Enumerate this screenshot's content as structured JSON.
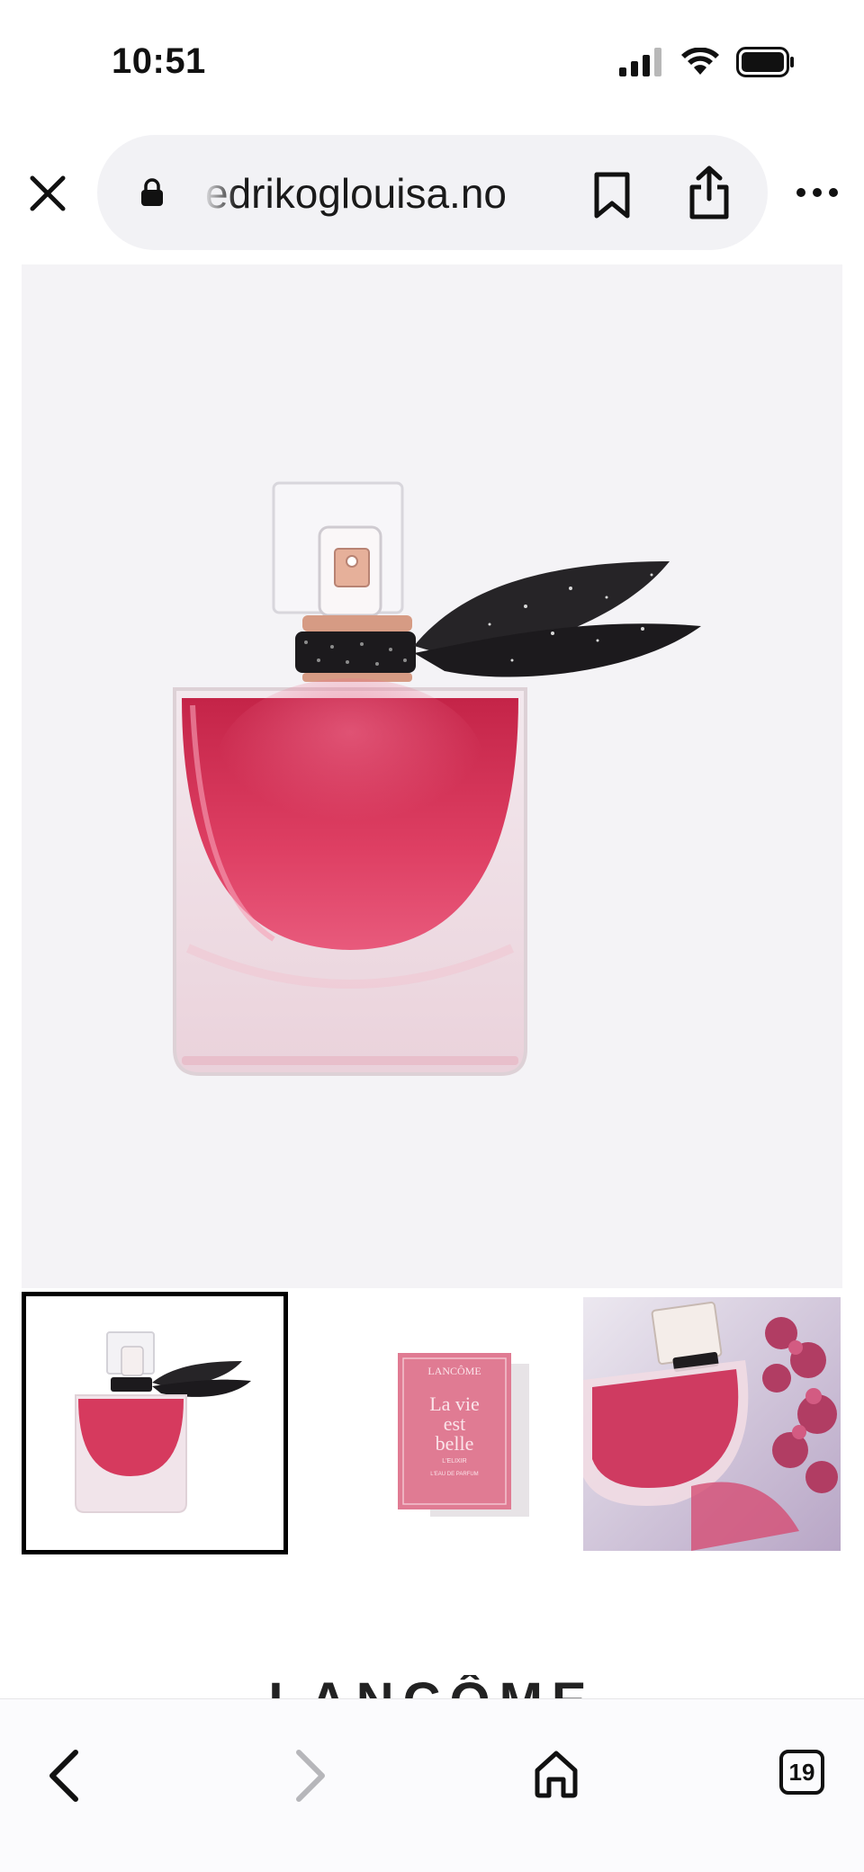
{
  "status_bar": {
    "time": "10:51",
    "icons": [
      "signal-icon",
      "wifi-icon",
      "battery-icon"
    ]
  },
  "browser": {
    "url_display": "edrikoglouisa.no",
    "secure": true,
    "buttons": [
      "close-icon",
      "bookmark-icon",
      "share-icon",
      "more-icon"
    ]
  },
  "product": {
    "main_image": "perfume-bottle-pink-black-bow",
    "thumbnails": [
      {
        "name": "bottle-front",
        "selected": true
      },
      {
        "name": "pink-box",
        "selected": false,
        "box_text": [
          "LANCÔME",
          "La vie",
          "est",
          "belle",
          "L'ELIXIR",
          "L'EAU DE PARFUM"
        ]
      },
      {
        "name": "bottle-lifestyle-berries",
        "selected": false
      }
    ]
  },
  "brand_peek": "LANCÔME",
  "toolbar": {
    "tabs_count": "19",
    "forward_enabled": false
  },
  "colors": {
    "hero_bg": "#f4f3f6",
    "liquid": "#d93a60",
    "box_pink": "#e07b93",
    "selected_border": "#000000"
  }
}
